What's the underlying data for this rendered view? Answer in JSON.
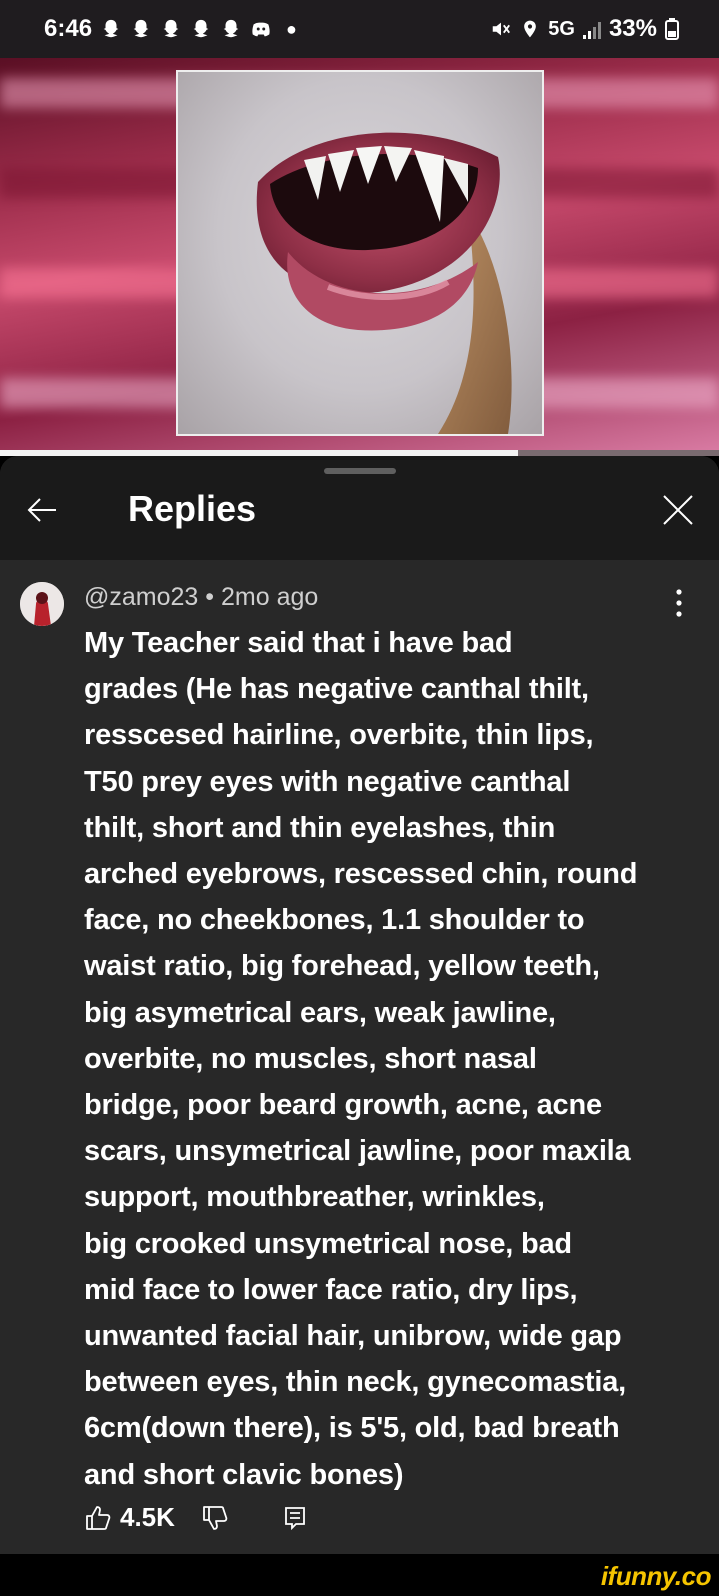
{
  "status_bar": {
    "time": "6:46",
    "network": "5G",
    "battery": "33%",
    "notification_icons": [
      "snapchat-icon",
      "snapchat-icon",
      "snapchat-icon",
      "snapchat-icon",
      "snapchat-icon",
      "discord-icon"
    ],
    "right_icons": [
      "mute-icon",
      "location-icon",
      "signal-icon",
      "battery-icon"
    ]
  },
  "video": {
    "progress_fraction": 0.72,
    "thumbnail_icon": "fanged-mouth-image"
  },
  "replies_panel": {
    "title": "Replies",
    "back_icon": "arrow-left-icon",
    "close_icon": "close-icon"
  },
  "comment": {
    "author": "@zamo23",
    "separator": "•",
    "time_ago": "2mo ago",
    "text_lines": [
      "My Teacher said that i have bad",
      "grades (He has negative canthal thilt,",
      "resscesed hairline, overbite, thin lips,",
      "T50 prey eyes with negative canthal",
      "thilt, short and thin eyelashes, thin",
      "arched eyebrows, rescessed chin, round",
      "face, no cheekbones, 1.1 shoulder to",
      "waist ratio, big forehead, yellow teeth,",
      "big asymetrical ears, weak jawline,",
      "overbite, no muscles, short nasal",
      "bridge, poor beard growth, acne, acne",
      "scars, unsymetrical jawline, poor maxila",
      "support, mouthbreather, wrinkles,",
      "big crooked unsymetrical nose, bad",
      "mid face to lower face ratio, dry lips,",
      "unwanted facial hair, unibrow, wide gap",
      "between eyes, thin neck, gynecomastia,",
      "6cm(down there), is 5'5, old, bad breath",
      "and short clavic bones)"
    ],
    "like_count": "4.5K"
  },
  "watermark": "ifunny.co",
  "colors": {
    "panel_bg": "#282828",
    "header_bg": "#1a1a1a",
    "watermark": "#f5c400"
  }
}
